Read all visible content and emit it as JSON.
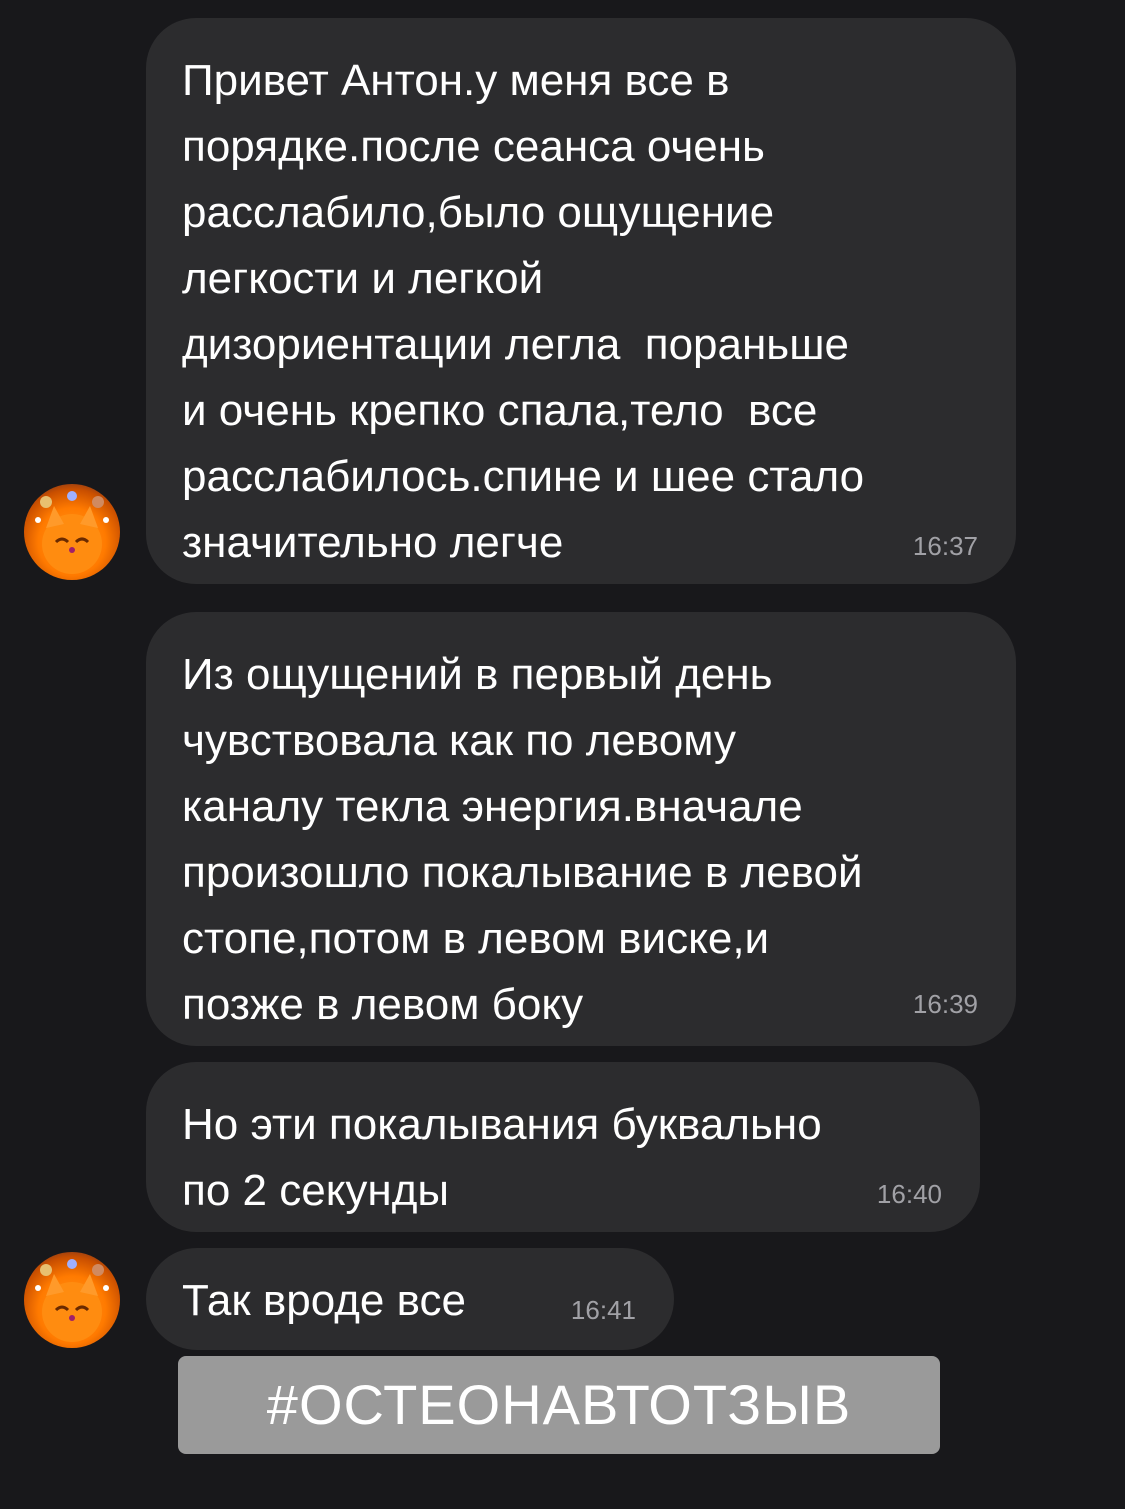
{
  "messages": [
    {
      "text": "Привет Антон.у меня все в\nпорядке.после сеанса очень\nрасслабило,было ощущение\nлегкости и легкой\nдизориентации легла  пораньше\nи очень крепко спала,тело  все\nрасслабилось.спине и шее стало\nзначительно легче",
      "time": "16:37"
    },
    {
      "text": "Из ощущений в первый день\nчувствовала как по левому\nканалу текла энергия.вначале\nпроизошло покалывание в левой\nстопе,потом в левом виске,и\nпозже в левом боку",
      "time": "16:39"
    },
    {
      "text": "Но эти покалывания буквально\nпо 2 секунды",
      "time": "16:40"
    },
    {
      "text": "Так вроде все",
      "time": "16:41"
    }
  ],
  "avatar": {
    "icon": "cat-avatar-icon",
    "colors": {
      "primary": "#ff7a00",
      "secondary": "#2a1a3a"
    }
  },
  "hashtag": "#ОСТЕОНАВТОТЗЫВ",
  "colors": {
    "background": "#18181b",
    "bubble": "#2c2c2e",
    "text": "#ffffff",
    "timestamp": "#a1a1a6",
    "hashtag_bg": "#9a9a9a"
  }
}
